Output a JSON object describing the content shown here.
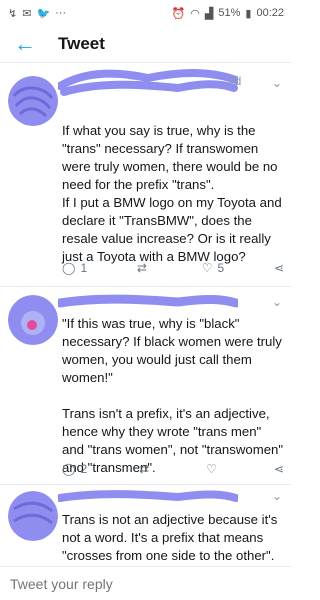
{
  "statusbar": {
    "battery": "51%",
    "time": "00:22"
  },
  "header": {
    "title": "Tweet"
  },
  "tweets": [
    {
      "time": "2d",
      "text": "If what you say is true, why is the \"trans\" necessary? If transwomen were truly women, there would be no need for the prefix \"trans\".\nIf I put a BMW logo on my Toyota and declare it \"TransBMW\", does the resale value increase? Or is it really just a Toyota with a BMW logo?",
      "replies": "1",
      "retweets": "",
      "likes": "5"
    },
    {
      "time": "",
      "text": "\"If this was true, why is \"black\" necessary? If black women were truly women, you would just call them women!\"\n\nTrans isn't a prefix, it's an adjective, hence why they wrote \"trans men\" and \"trans women\", not \"transwomen\" and \"transmen\".",
      "replies": "2",
      "retweets": "",
      "likes": ""
    },
    {
      "time": "",
      "text": "Trans is not an adjective because it's not a word. It's a prefix that means \"crosses from one side to the other\".",
      "replies": "",
      "retweets": "",
      "likes": ""
    }
  ],
  "reply_bar": {
    "placeholder": "Tweet your reply"
  },
  "colors": {
    "accent": "#1da1f2",
    "scribble": "#8f8ef0"
  }
}
